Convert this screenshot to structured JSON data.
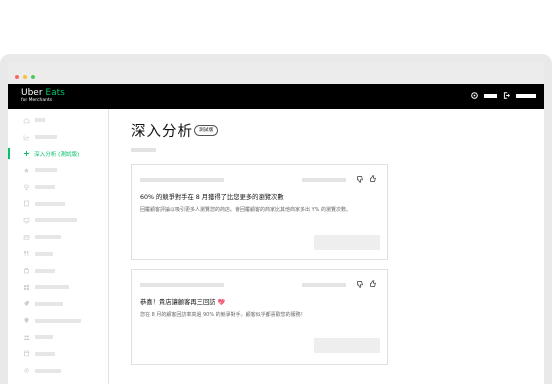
{
  "colors": {
    "brand_green": "#06c167",
    "topbar": "#000000",
    "placeholder": "#e6e6e6",
    "dot_red": "#f26b6b",
    "dot_yellow": "#f5c242",
    "dot_green": "#57c75a"
  },
  "brand": {
    "name_part1": "Uber ",
    "name_part2": "Eats",
    "sub": "for Merchants"
  },
  "topbar_icons": [
    "help-icon",
    "logout-icon"
  ],
  "sidebar": {
    "active_label": "深入分析 (測試版)",
    "items": [
      {
        "icon": "home-icon"
      },
      {
        "icon": "chart-icon"
      },
      {
        "icon": "plus-icon",
        "active": true
      },
      {
        "icon": "star-icon"
      },
      {
        "icon": "trophy-icon"
      },
      {
        "icon": "receipt-icon"
      },
      {
        "icon": "monitor-icon"
      },
      {
        "icon": "card-icon"
      },
      {
        "icon": "utensils-icon"
      },
      {
        "icon": "bag-icon"
      },
      {
        "icon": "grid-icon"
      },
      {
        "icon": "tag-icon"
      },
      {
        "icon": "pin-icon"
      },
      {
        "icon": "users-icon"
      },
      {
        "icon": "store-icon"
      },
      {
        "icon": "gear-icon"
      }
    ]
  },
  "page": {
    "title": "深入分析",
    "badge": "測試版"
  },
  "cards": [
    {
      "title": "60% 的競爭對手在 8 月獲得了比您更多的瀏覽次數",
      "body": "回覆顧客評論以吸引更多人瀏覽您的商店。會回覆顧客的商家比其他商家多出 Y% 的瀏覽次數。"
    },
    {
      "title": "恭喜！貴店讓顧客再三回訪",
      "body": "您在 8 月的顧客回訪率高過 90% 的競爭對手。顧客似乎都喜歡您的服務！"
    }
  ]
}
